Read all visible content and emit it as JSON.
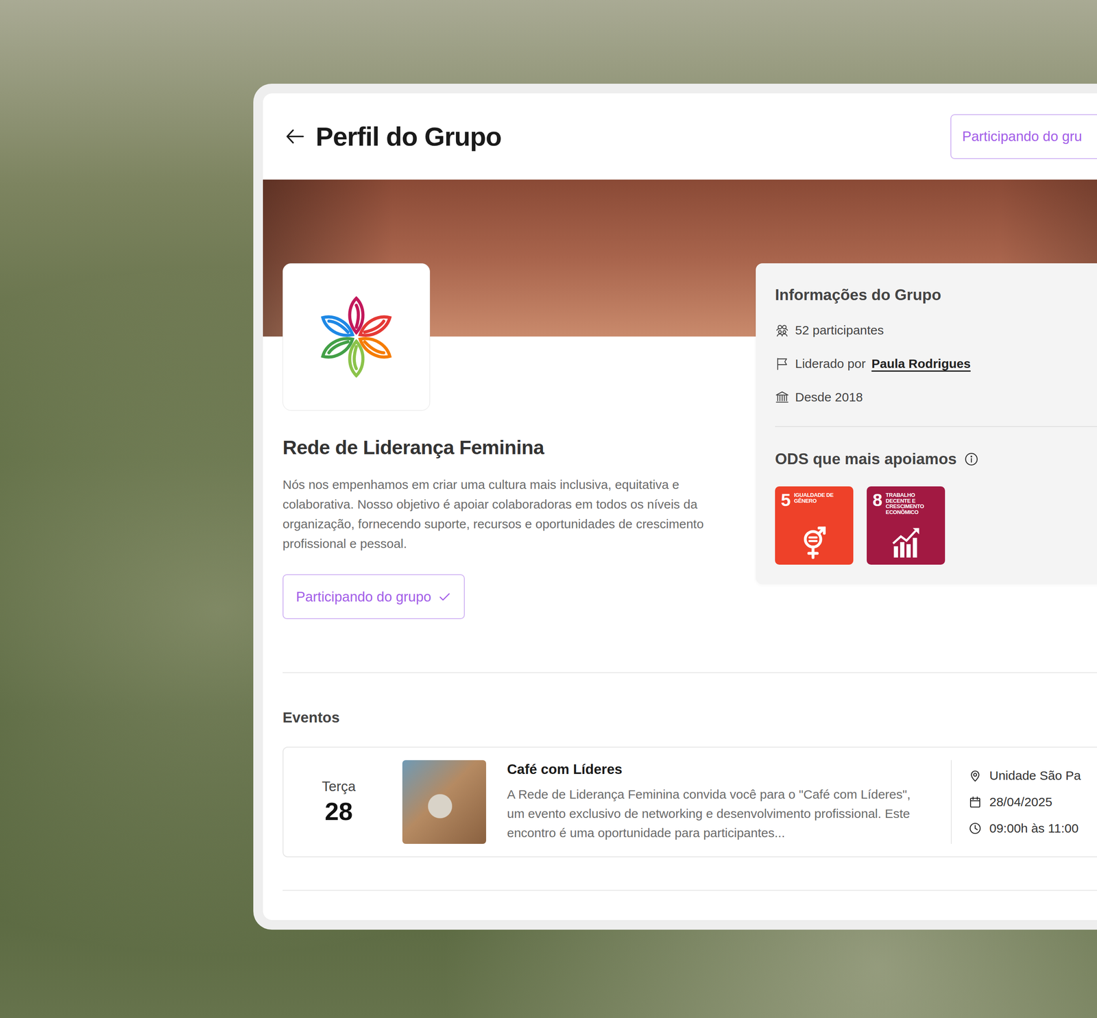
{
  "header": {
    "title": "Perfil do Grupo",
    "join_button": {
      "label": "Participando do gru",
      "joined": true
    }
  },
  "group": {
    "name": "Rede de Liderança Feminina",
    "description": "Nós nos empenhamos em criar uma cultura mais inclusiva, equitativa e colaborativa. Nosso objetivo é apoiar colaboradoras em todos os níveis da organização, fornecendo suporte, recursos e oportunidades de crescimento profissional e pessoal.",
    "join_button": {
      "label": "Participando do grupo",
      "joined": true
    }
  },
  "info": {
    "title": "Informações do Grupo",
    "items": [
      {
        "kind": "participants",
        "text": "52 participantes"
      },
      {
        "kind": "leader",
        "text": "Liderado por",
        "link": "Paula Rodrigues"
      },
      {
        "kind": "since",
        "text": "Desde 2018"
      }
    ]
  },
  "ods": {
    "title": "ODS que mais apoiamos",
    "goals": [
      {
        "number": "5",
        "label": "IGUALDADE DE GÊNERO",
        "kind": "gender",
        "color": "#ee4129"
      },
      {
        "number": "8",
        "label": "TRABALHO DECENTE E CRESCIMENTO ECONÔMICO",
        "kind": "growth",
        "color": "#a21942"
      }
    ]
  },
  "events": {
    "title": "Eventos",
    "items": [
      {
        "weekday": "Terça",
        "day": "28",
        "title": "Café com Líderes",
        "description": "A Rede de Liderança Feminina convida você para o \"Café com Líderes\", um evento exclusivo de networking e desenvolvimento profissional. Este encontro é uma oportunidade para participantes...",
        "location": "Unidade São Pa",
        "date": "28/04/2025",
        "time": "09:00h às 11:00"
      }
    ]
  }
}
